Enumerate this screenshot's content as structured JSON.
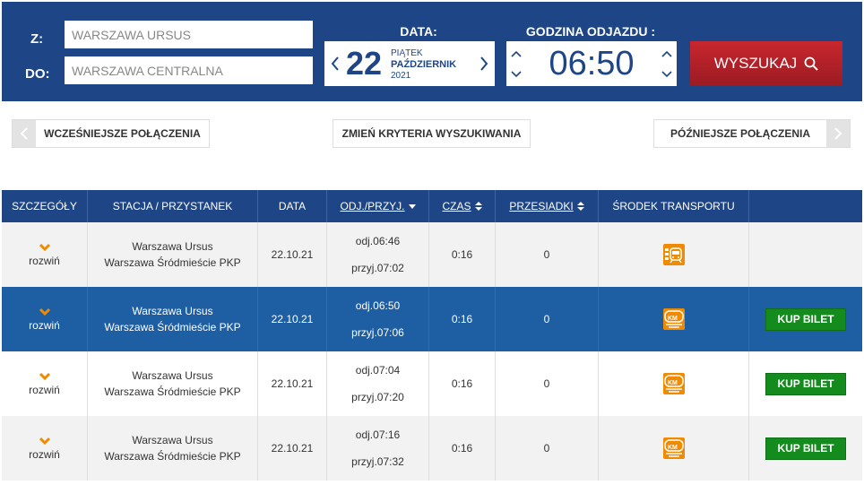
{
  "search": {
    "from_label": "Z:",
    "to_label": "DO:",
    "from_value": "WARSZAWA URSUS",
    "to_value": "WARSZAWA CENTRALNA",
    "date_label": "DATA:",
    "date_day": "22",
    "date_weekday": "PIĄTEK",
    "date_month": "PAŹDZIERNIK",
    "date_year": "2021",
    "time_label": "GODZINA ODJAZDU :",
    "time_value": "06:50",
    "search_button": "WYSZUKAJ"
  },
  "nav": {
    "earlier": "WCZEŚNIEJSZE POŁĄCZENIA",
    "change": "ZMIEŃ KRYTERIA WYSZUKIWANIA",
    "later": "PÓŹNIEJSZE POŁĄCZENIA"
  },
  "table": {
    "headers": [
      "SZCZEGÓŁY",
      "STACJA / PRZYSTANEK",
      "DATA",
      "ODJ./PRZYJ.",
      "CZAS",
      "PRZESIADKI",
      "ŚRODEK TRANSPORTU",
      ""
    ],
    "expand_label": "rozwiń",
    "buy_label": "KUP BILET",
    "rows": [
      {
        "from": "Warszawa Ursus",
        "to": "Warszawa Śródmieście PKP",
        "date": "22.10.21",
        "dep": "odj.06:46",
        "arr": "przyj.07:02",
        "duration": "0:16",
        "transfers": "0",
        "carrier_icon": "skm-train-icon"
      },
      {
        "from": "Warszawa Ursus",
        "to": "Warszawa Śródmieście PKP",
        "date": "22.10.21",
        "dep": "odj.06:50",
        "arr": "przyj.07:06",
        "duration": "0:16",
        "transfers": "0",
        "carrier_icon": "km-train-icon"
      },
      {
        "from": "Warszawa Ursus",
        "to": "Warszawa Śródmieście PKP",
        "date": "22.10.21",
        "dep": "odj.07:04",
        "arr": "przyj.07:20",
        "duration": "0:16",
        "transfers": "0",
        "carrier_icon": "km-train-icon"
      },
      {
        "from": "Warszawa Ursus",
        "to": "Warszawa Śródmieście PKP",
        "date": "22.10.21",
        "dep": "odj.07:16",
        "arr": "przyj.07:32",
        "duration": "0:16",
        "transfers": "0",
        "carrier_icon": "km-train-icon"
      }
    ]
  },
  "colors": {
    "primary": "#1e4585",
    "selected_row": "#1e5ea3",
    "search_red": "#c8262e",
    "buy_green": "#148b1d",
    "accent_orange": "#f08a00"
  }
}
